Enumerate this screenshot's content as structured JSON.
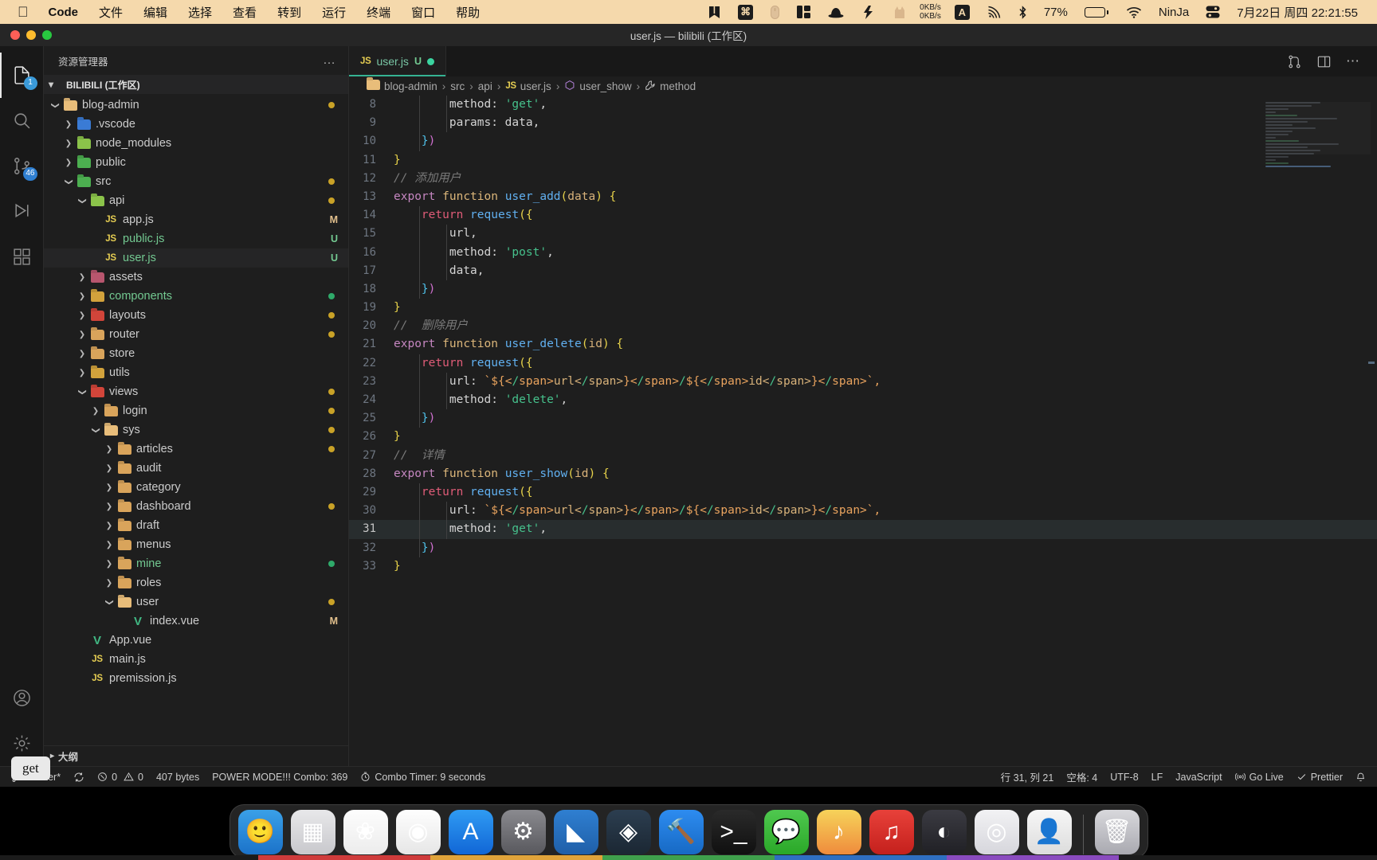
{
  "menubar": {
    "apple_icon": "apple-logo",
    "app_name": "Code",
    "items": [
      "文件",
      "编辑",
      "选择",
      "查看",
      "转到",
      "运行",
      "终端",
      "窗口",
      "帮助"
    ],
    "right_icons": [
      "bookmark-icon",
      "command-key-icon",
      "mouse-icon",
      "layout-icon",
      "hat-icon",
      "lightning-icon",
      "cat-icon"
    ],
    "network_up": "0KB/s",
    "network_down": "0KB/s",
    "input_method": "A",
    "airplay_icon": "airplay-icon",
    "bluetooth_icon": "bluetooth-icon",
    "battery_percent": "77%",
    "wifi_icon": "wifi-icon",
    "user_name": "NinJa",
    "control_center_icon": "control-center-icon",
    "datetime": "7月22日 周四 22:21:55"
  },
  "window": {
    "title": "user.js — bilibili (工作区)"
  },
  "activitybar": {
    "items": [
      {
        "name": "explorer",
        "icon": "files-icon",
        "badge": "1"
      },
      {
        "name": "search",
        "icon": "search-icon",
        "badge": ""
      },
      {
        "name": "source-control",
        "icon": "source-control-icon",
        "badge": "46"
      },
      {
        "name": "run-and-debug",
        "icon": "run-debug-icon",
        "badge": ""
      },
      {
        "name": "extensions",
        "icon": "extensions-icon",
        "badge": ""
      }
    ],
    "bottom": [
      {
        "name": "accounts",
        "icon": "account-icon"
      },
      {
        "name": "manage",
        "icon": "gear-icon"
      }
    ]
  },
  "sidebar": {
    "title": "资源管理器",
    "more_actions": "…",
    "workspace": "BILIBILI (工作区)",
    "outline_label": "大纲",
    "tree": [
      {
        "label": "blog-admin",
        "depth": 1,
        "twisty": "down",
        "icon": "folder-open-tan",
        "state": "",
        "badge": "",
        "dot": "#c9a227"
      },
      {
        "label": ".vscode",
        "depth": 2,
        "twisty": "right",
        "icon": "folder-vscode",
        "state": "",
        "badge": "",
        "dot": ""
      },
      {
        "label": "node_modules",
        "depth": 2,
        "twisty": "right",
        "icon": "folder-node",
        "state": "",
        "badge": "",
        "dot": ""
      },
      {
        "label": "public",
        "depth": 2,
        "twisty": "right",
        "icon": "folder-public",
        "state": "",
        "badge": "",
        "dot": ""
      },
      {
        "label": "src",
        "depth": 2,
        "twisty": "down",
        "icon": "folder-src",
        "state": "",
        "badge": "",
        "dot": "#c9a227"
      },
      {
        "label": "api",
        "depth": 3,
        "twisty": "down",
        "icon": "folder-api",
        "state": "",
        "badge": "",
        "dot": "#c9a227"
      },
      {
        "label": "app.js",
        "depth": 4,
        "twisty": "none",
        "icon": "js-file",
        "state": "modified",
        "badge": "M",
        "dot": ""
      },
      {
        "label": "public.js",
        "depth": 4,
        "twisty": "none",
        "icon": "js-file",
        "state": "untracked",
        "badge": "U",
        "dot": ""
      },
      {
        "label": "user.js",
        "depth": 4,
        "twisty": "none",
        "icon": "js-file",
        "state": "untracked",
        "badge": "U",
        "dot": "",
        "selected": true
      },
      {
        "label": "assets",
        "depth": 3,
        "twisty": "right",
        "icon": "folder-assets",
        "state": "",
        "badge": "",
        "dot": ""
      },
      {
        "label": "components",
        "depth": 3,
        "twisty": "right",
        "icon": "folder-components",
        "state": "untracked",
        "badge": "",
        "dot": "#2faa6a"
      },
      {
        "label": "layouts",
        "depth": 3,
        "twisty": "right",
        "icon": "folder-layouts",
        "state": "",
        "badge": "",
        "dot": "#c9a227"
      },
      {
        "label": "router",
        "depth": 3,
        "twisty": "right",
        "icon": "folder-tan",
        "state": "",
        "badge": "",
        "dot": "#c9a227"
      },
      {
        "label": "store",
        "depth": 3,
        "twisty": "right",
        "icon": "folder-tan",
        "state": "",
        "badge": "",
        "dot": ""
      },
      {
        "label": "utils",
        "depth": 3,
        "twisty": "right",
        "icon": "folder-utils",
        "state": "",
        "badge": "",
        "dot": ""
      },
      {
        "label": "views",
        "depth": 3,
        "twisty": "down",
        "icon": "folder-views",
        "state": "",
        "badge": "",
        "dot": "#c9a227"
      },
      {
        "label": "login",
        "depth": 4,
        "twisty": "right",
        "icon": "folder-tan",
        "state": "",
        "badge": "",
        "dot": "#c9a227"
      },
      {
        "label": "sys",
        "depth": 4,
        "twisty": "down",
        "icon": "folder-open-tan",
        "state": "",
        "badge": "",
        "dot": "#c9a227"
      },
      {
        "label": "articles",
        "depth": 5,
        "twisty": "right",
        "icon": "folder-tan",
        "state": "",
        "badge": "",
        "dot": "#c9a227"
      },
      {
        "label": "audit",
        "depth": 5,
        "twisty": "right",
        "icon": "folder-tan",
        "state": "",
        "badge": "",
        "dot": ""
      },
      {
        "label": "category",
        "depth": 5,
        "twisty": "right",
        "icon": "folder-tan",
        "state": "",
        "badge": "",
        "dot": ""
      },
      {
        "label": "dashboard",
        "depth": 5,
        "twisty": "right",
        "icon": "folder-tan",
        "state": "",
        "badge": "",
        "dot": "#c9a227"
      },
      {
        "label": "draft",
        "depth": 5,
        "twisty": "right",
        "icon": "folder-tan",
        "state": "",
        "badge": "",
        "dot": ""
      },
      {
        "label": "menus",
        "depth": 5,
        "twisty": "right",
        "icon": "folder-tan",
        "state": "",
        "badge": "",
        "dot": ""
      },
      {
        "label": "mine",
        "depth": 5,
        "twisty": "right",
        "icon": "folder-tan",
        "state": "untracked",
        "badge": "",
        "dot": "#2faa6a"
      },
      {
        "label": "roles",
        "depth": 5,
        "twisty": "right",
        "icon": "folder-tan",
        "state": "",
        "badge": "",
        "dot": ""
      },
      {
        "label": "user",
        "depth": 5,
        "twisty": "down",
        "icon": "folder-open-tan",
        "state": "",
        "badge": "",
        "dot": "#c9a227"
      },
      {
        "label": "index.vue",
        "depth": 6,
        "twisty": "none",
        "icon": "vue-file",
        "state": "modified",
        "badge": "M",
        "dot": ""
      },
      {
        "label": "App.vue",
        "depth": 3,
        "twisty": "none",
        "icon": "vue-file",
        "state": "",
        "badge": "",
        "dot": ""
      },
      {
        "label": "main.js",
        "depth": 3,
        "twisty": "none",
        "icon": "js-file",
        "state": "",
        "badge": "",
        "dot": ""
      },
      {
        "label": "premission.js",
        "depth": 3,
        "twisty": "none",
        "icon": "js-file",
        "state": "",
        "badge": "",
        "dot": ""
      }
    ]
  },
  "editor": {
    "tab": {
      "icon": "js-file",
      "name": "user.js",
      "badge": "U",
      "dirty": true
    },
    "toolbar_icons": [
      "split-editor-icon",
      "open-changes-icon",
      "more-actions-icon"
    ],
    "breadcrumb": [
      {
        "icon": "folder-open-tan",
        "label": "blog-admin"
      },
      {
        "icon": "",
        "label": "src"
      },
      {
        "icon": "",
        "label": "api"
      },
      {
        "icon": "js-file",
        "label": "user.js"
      },
      {
        "icon": "symbol-function-icon",
        "label": "user_show"
      },
      {
        "icon": "symbol-property-icon",
        "label": "method"
      }
    ],
    "lines": [
      {
        "n": 8,
        "indent": 2
      },
      {
        "n": 9,
        "indent": 2
      },
      {
        "n": 10,
        "indent": 1
      },
      {
        "n": 11,
        "indent": 0
      },
      {
        "n": 12,
        "indent": 0
      },
      {
        "n": 13,
        "indent": 0
      },
      {
        "n": 14,
        "indent": 1
      },
      {
        "n": 15,
        "indent": 2
      },
      {
        "n": 16,
        "indent": 2
      },
      {
        "n": 17,
        "indent": 2
      },
      {
        "n": 18,
        "indent": 1
      },
      {
        "n": 19,
        "indent": 0
      },
      {
        "n": 20,
        "indent": 0
      },
      {
        "n": 21,
        "indent": 0
      },
      {
        "n": 22,
        "indent": 1
      },
      {
        "n": 23,
        "indent": 2
      },
      {
        "n": 24,
        "indent": 2
      },
      {
        "n": 25,
        "indent": 1
      },
      {
        "n": 26,
        "indent": 0
      },
      {
        "n": 27,
        "indent": 0
      },
      {
        "n": 28,
        "indent": 0
      },
      {
        "n": 29,
        "indent": 1
      },
      {
        "n": 30,
        "indent": 2
      },
      {
        "n": 31,
        "indent": 2
      },
      {
        "n": 32,
        "indent": 1
      },
      {
        "n": 33,
        "indent": 0
      }
    ],
    "source_text": [
      "        method: 'get',",
      "        params: data,",
      "    })",
      "}",
      "// 添加用户",
      "export function user_add(data) {",
      "    return request({",
      "        url,",
      "        method: 'post',",
      "        data,",
      "    })",
      "}",
      "//  删除用户",
      "export function user_delete(id) {",
      "    return request({",
      "        url: `${url}/${id}`,",
      "        method: 'delete',",
      "    })",
      "}",
      "//  详情",
      "export function user_show(id) {",
      "    return request({",
      "        url: `${url}/${id}`,",
      "        method: 'get',",
      "    })",
      "}"
    ],
    "highlighted_line": 31
  },
  "statusbar": {
    "left": [
      {
        "name": "branch",
        "icon": "source-control-icon",
        "text": "master*"
      },
      {
        "name": "sync",
        "icon": "sync-icon",
        "text": ""
      },
      {
        "name": "problems",
        "icon": "error-warning-icon",
        "text": "0  0",
        "errors": "0",
        "warnings": "0"
      },
      {
        "name": "file-size",
        "icon": "",
        "text": "407 bytes"
      },
      {
        "name": "power-mode",
        "icon": "",
        "text": "POWER MODE!!! Combo: 369"
      },
      {
        "name": "combo-timer",
        "icon": "timer-icon",
        "text": "Combo Timer: 9 seconds"
      }
    ],
    "right": [
      {
        "name": "cursor-position",
        "icon": "",
        "text": "行 31, 列 21"
      },
      {
        "name": "indentation",
        "icon": "",
        "text": "空格: 4"
      },
      {
        "name": "encoding",
        "icon": "",
        "text": "UTF-8"
      },
      {
        "name": "eol",
        "icon": "",
        "text": "LF"
      },
      {
        "name": "language-mode",
        "icon": "",
        "text": "JavaScript"
      },
      {
        "name": "go-live",
        "icon": "broadcast-icon",
        "text": "Go Live"
      },
      {
        "name": "prettier",
        "icon": "check-icon",
        "text": "Prettier"
      },
      {
        "name": "notifications",
        "icon": "bell-icon",
        "text": ""
      }
    ]
  },
  "dock": {
    "items": [
      {
        "name": "finder",
        "glyph": "🙂",
        "bg": "linear-gradient(180deg,#3aa0e8,#1b72c9)",
        "running": true
      },
      {
        "name": "launchpad",
        "glyph": "▦",
        "bg": "linear-gradient(180deg,#e8e8ea,#c8c8cc)",
        "running": false
      },
      {
        "name": "photos",
        "glyph": "❀",
        "bg": "linear-gradient(180deg,#fdfdfd,#ececec)",
        "running": false
      },
      {
        "name": "chrome",
        "glyph": "◉",
        "bg": "linear-gradient(180deg,#fefefe,#e6e6e6)",
        "running": true
      },
      {
        "name": "app-store",
        "glyph": "A",
        "bg": "linear-gradient(180deg,#2f9bf3,#1166d6)",
        "running": false
      },
      {
        "name": "system-settings",
        "glyph": "⚙",
        "bg": "linear-gradient(180deg,#8a8a8f,#58585d)",
        "running": false
      },
      {
        "name": "visual-studio-code",
        "glyph": "◣",
        "bg": "linear-gradient(180deg,#2f7fd1,#1f5fa8)",
        "running": true
      },
      {
        "name": "sourcetree",
        "glyph": "◈",
        "bg": "linear-gradient(180deg,#2c3e50,#1b2733)",
        "running": true
      },
      {
        "name": "xcode-tools",
        "glyph": "🔨",
        "bg": "linear-gradient(180deg,#2d8cf0,#1769c4)",
        "running": false
      },
      {
        "name": "terminal",
        "glyph": ">_",
        "bg": "linear-gradient(180deg,#2a2a2a,#101010)",
        "running": true
      },
      {
        "name": "wechat",
        "glyph": "💬",
        "bg": "linear-gradient(180deg,#4fc84f,#2aa828)",
        "running": true
      },
      {
        "name": "qq-music",
        "glyph": "♪",
        "bg": "linear-gradient(180deg,#f6d35a,#ef8b3c)",
        "running": true
      },
      {
        "name": "netease-music",
        "glyph": "♫",
        "bg": "linear-gradient(180deg,#e8413a,#c4201c)",
        "running": true
      },
      {
        "name": "keynote",
        "glyph": "◐",
        "bg": "linear-gradient(180deg,#3b3b42,#202025)",
        "running": true
      },
      {
        "name": "safari",
        "glyph": "◎",
        "bg": "linear-gradient(180deg,#f2f2f4,#d6d6dc)",
        "running": true
      },
      {
        "name": "contacts",
        "glyph": "👤",
        "bg": "linear-gradient(180deg,#f7f7f7,#dcdcdc)",
        "running": true
      }
    ],
    "trash": {
      "name": "trash",
      "glyph": "🗑"
    },
    "tooltip": "get"
  }
}
